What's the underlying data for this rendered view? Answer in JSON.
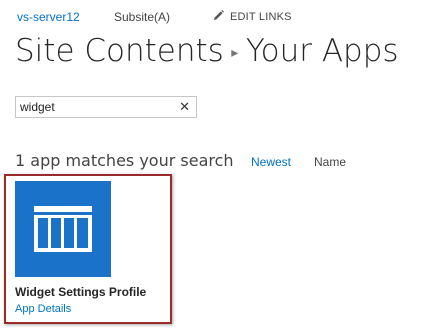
{
  "topnav": {
    "site_link": "vs-server12",
    "subsite": "Subsite(A)",
    "edit_links": "EDIT LINKS",
    "edit_icon": "pencil-icon"
  },
  "breadcrumb": {
    "parent": "Site Contents",
    "separator_icon": "chevron-right-icon",
    "current": "Your Apps"
  },
  "search": {
    "value": "widget",
    "clear_icon": "close-icon"
  },
  "results": {
    "count_text": "1 app matches your search",
    "sort_newest": "Newest",
    "sort_name": "Name"
  },
  "apps": [
    {
      "name": "Widget Settings Profile",
      "details_link": "App Details",
      "icon": "list-app-icon",
      "tile_color": "#1b73c9"
    }
  ],
  "colors": {
    "link": "#0072c6",
    "highlight_border": "#9b2a2a",
    "tile": "#1b73c9"
  }
}
